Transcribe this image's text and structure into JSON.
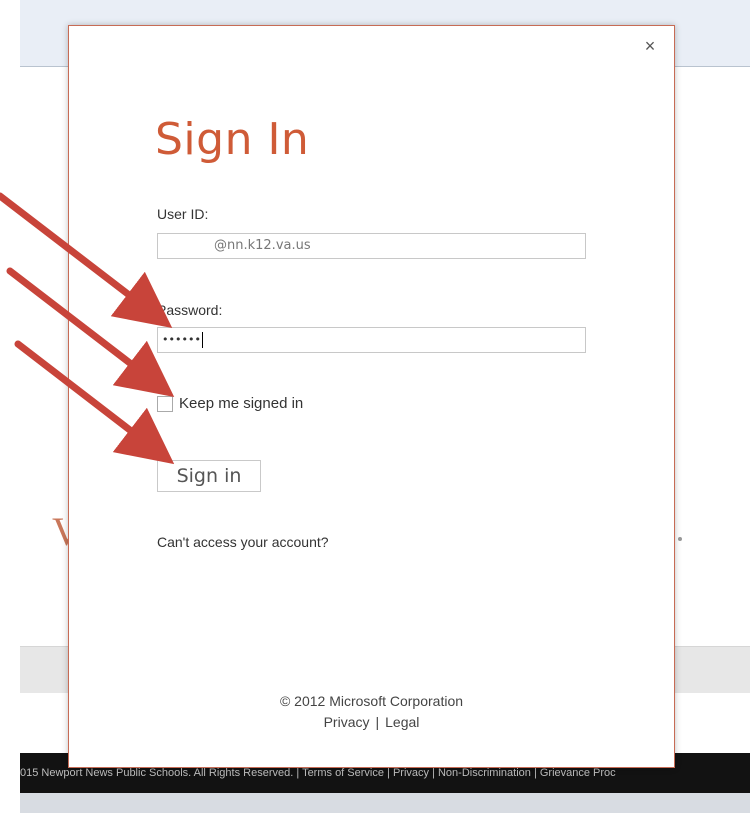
{
  "background": {
    "footer_text": "015 Newport News Public Schools. All Rights Reserved. | Terms of Service | Privacy | Non-Discrimination | Grievance Proc",
    "side_letter": "V"
  },
  "modal": {
    "close_symbol": "×",
    "title": "Sign In",
    "user_id_label": "User ID:",
    "user_id_value": "@nn.k12.va.us",
    "password_label": "Password:",
    "password_value": "••••••",
    "keep_signed_in_label": "Keep me signed in",
    "sign_in_button": "Sign in",
    "cant_access_link": "Can't access your account?",
    "copyright": "© 2012 Microsoft Corporation",
    "footer_links": {
      "privacy": "Privacy",
      "separator": "|",
      "legal": "Legal"
    }
  },
  "colors": {
    "accent": "#cf5b37",
    "arrow": "#c8443a",
    "footer_bg": "#121212"
  },
  "icons": {
    "close": "close-icon",
    "arrow": "arrow-annotation"
  }
}
